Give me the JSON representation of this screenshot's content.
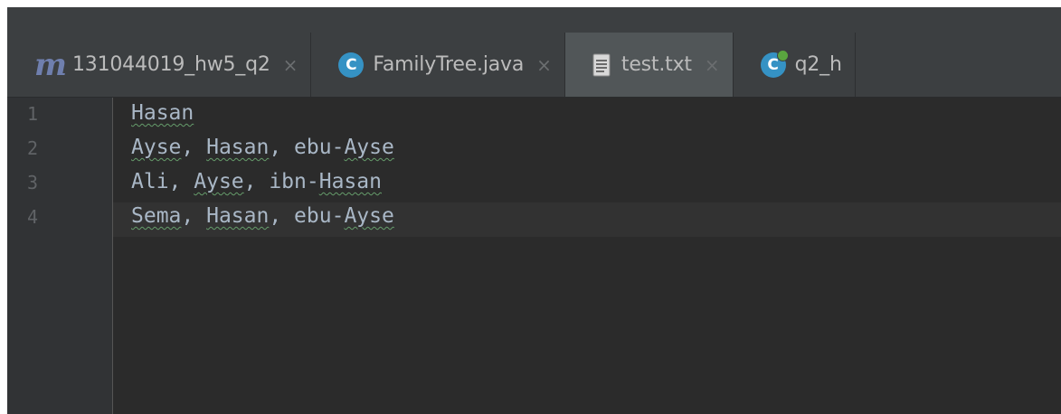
{
  "tabs": [
    {
      "label": "131044019_hw5_q2",
      "icon": "maven-module-icon",
      "active": false
    },
    {
      "label": "FamilyTree.java",
      "icon": "java-class-icon",
      "active": false
    },
    {
      "label": "test.txt",
      "icon": "text-file-icon",
      "active": true
    },
    {
      "label": "q2_h",
      "icon": "java-class-with-main-icon",
      "active": false
    }
  ],
  "close_glyph": "×",
  "editor": {
    "line_numbers": [
      "1",
      "2",
      "3",
      "4"
    ],
    "lines": [
      [
        {
          "t": "Hasan",
          "typo": true
        }
      ],
      [
        {
          "t": "Ayse",
          "typo": true
        },
        {
          "t": ", "
        },
        {
          "t": "Hasan",
          "typo": true
        },
        {
          "t": ", ebu-"
        },
        {
          "t": "Ayse",
          "typo": true
        }
      ],
      [
        {
          "t": "Ali, "
        },
        {
          "t": "Ayse",
          "typo": true
        },
        {
          "t": ", ibn-"
        },
        {
          "t": "Hasan",
          "typo": true
        }
      ],
      [
        {
          "t": "Sema",
          "typo": true
        },
        {
          "t": ", "
        },
        {
          "t": "Hasan",
          "typo": true
        },
        {
          "t": ", ebu-"
        },
        {
          "t": "Ayse",
          "typo": true
        }
      ]
    ],
    "caret_line": 4
  },
  "colors": {
    "editor_bg": "#2b2b2b",
    "gutter_bg": "#313335",
    "tab_bar_bg": "#3c3f41",
    "active_tab_bg": "#515658",
    "text": "#a9b7c6",
    "typo_underline": "#659c6b",
    "class_icon": "#3592c4"
  }
}
